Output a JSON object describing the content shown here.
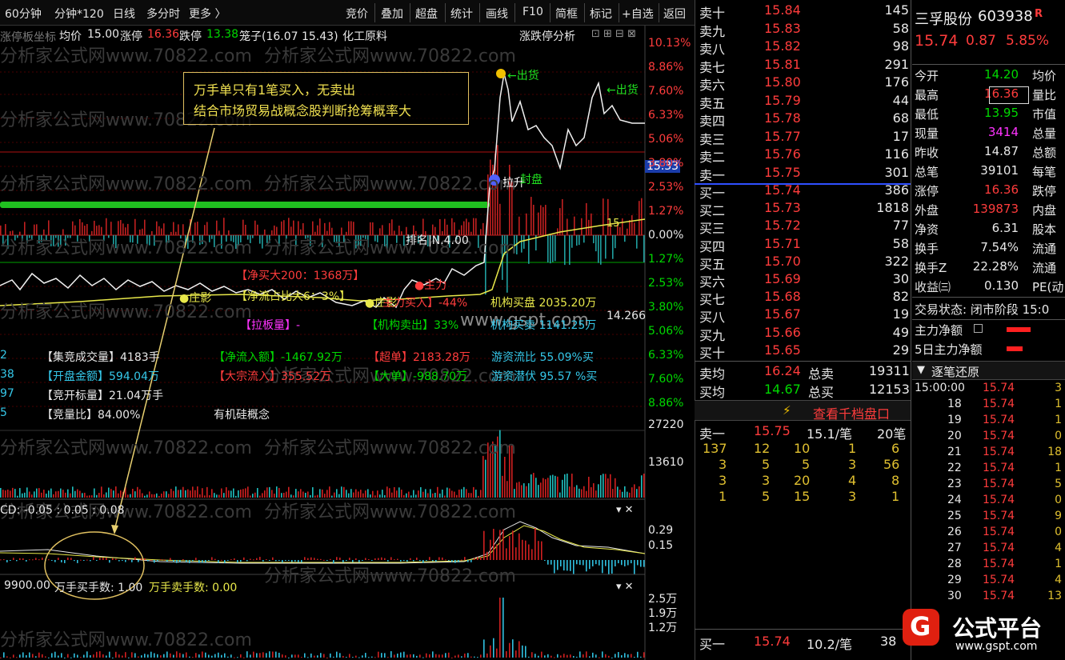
{
  "toolbar": {
    "left": [
      "60分钟",
      "分钟*120",
      "日线",
      "多分时",
      "更多 〉"
    ],
    "right": [
      "竞价",
      "叠加",
      "超盘",
      "统计",
      "画线",
      "F10",
      "简框",
      "标记",
      "+自选",
      "返回"
    ]
  },
  "header": {
    "mode": "涨停板坐标",
    "avg_label": "均价",
    "avg": "15.00",
    "up_label": "涨停",
    "up": "16.36",
    "down_label": "跌停",
    "down": "13.38",
    "cage": "笼子(16.07 15.43)",
    "sector": "化工原料",
    "analysis": "涨跌停分析"
  },
  "watermarks": [
    "分析家公式网www.70822.com",
    "www.gspt.com"
  ],
  "annotation": {
    "line1": "万手单只有1笔买入，无卖出",
    "line2": "结合市场贸易战概念股判断抢筹概率大"
  },
  "chart_labels": {
    "sell1": "←出货",
    "sell2": "←出货",
    "limit": "拉升",
    "sealed": "封盘",
    "rank": "排名|N.4.00",
    "net200": "【净买大200：1368万】",
    "zhuangying1": "●庄影",
    "netratio": "【净流占比大6：3%】",
    "zhuangying2": "●庄影",
    "zhuli": "●主力",
    "zhuli_in": "主力买入】-44%",
    "jigou_buy": "机构买盘 2035.20万",
    "laban": "【拉板量】-",
    "jigou_sell": "【机构卖出】33%",
    "jigou_net": "机构买卖 1141.25万",
    "price_low": "14.266",
    "ma15": "15",
    "price_tag": "15.33"
  },
  "info": {
    "left": [
      "2",
      "38",
      "97",
      "5"
    ],
    "jj_vol": "【集竞成交量】4183手",
    "open_amt": "【开盘金额】594.04万",
    "jk_vol": "【竞开标量】21.04万手",
    "jl_ratio": "【竞量比】84.00%",
    "net_in": "【净流入额】-1467.92万",
    "big_in": "【大宗流入】355.52万",
    "super": "【超单】2183.28万",
    "big": "【大单】-988.70万",
    "yz_ratio": "游资流比 55.09%买",
    "yz_hide": "游资潜伏 95.57 %买",
    "concept": "有机硅概念"
  },
  "pct_axis": [
    "10.13%",
    "8.86%",
    "7.60%",
    "6.33%",
    "5.06%",
    "3.80%",
    "2.53%",
    "1.27%",
    "0.00%",
    "1.27%",
    "2.53%",
    "3.80%",
    "5.06%",
    "6.33%",
    "7.60%",
    "8.86%"
  ],
  "vol_axis": [
    "27220",
    "13610"
  ],
  "macd": {
    "label": "CD: -0.05 : 0.05 : 0.08",
    "axis": [
      "0.29",
      "0.15"
    ]
  },
  "wan": {
    "left": "9900.00",
    "buy": "万手买手数: 1.00",
    "sell": "万手卖手数: 0.00",
    "axis": [
      "2.5万",
      "1.9万",
      "1.2万"
    ]
  },
  "orderbook": {
    "sell": [
      [
        "卖十",
        "15.84",
        "145"
      ],
      [
        "卖九",
        "15.83",
        "58"
      ],
      [
        "卖八",
        "15.82",
        "98"
      ],
      [
        "卖七",
        "15.81",
        "291"
      ],
      [
        "卖六",
        "15.80",
        "176"
      ],
      [
        "卖五",
        "15.79",
        "44"
      ],
      [
        "卖四",
        "15.78",
        "68"
      ],
      [
        "卖三",
        "15.77",
        "17"
      ],
      [
        "卖二",
        "15.76",
        "116"
      ],
      [
        "卖一",
        "15.75",
        "301"
      ]
    ],
    "buy": [
      [
        "买一",
        "15.74",
        "386"
      ],
      [
        "买二",
        "15.73",
        "1818"
      ],
      [
        "买三",
        "15.72",
        "77"
      ],
      [
        "买四",
        "15.71",
        "58"
      ],
      [
        "买五",
        "15.70",
        "322"
      ],
      [
        "买六",
        "15.69",
        "30"
      ],
      [
        "买七",
        "15.68",
        "82"
      ],
      [
        "买八",
        "15.67",
        "19"
      ],
      [
        "买九",
        "15.66",
        "49"
      ],
      [
        "买十",
        "15.65",
        "29"
      ]
    ],
    "sell_avg_l": "卖均",
    "sell_avg": "16.24",
    "total_sell_l": "总卖",
    "total_sell": "19311",
    "buy_avg_l": "买均",
    "buy_avg": "14.67",
    "total_buy_l": "总买",
    "total_buy": "12153",
    "queue_title": "查看千档盘口",
    "queue_head": [
      "卖一",
      "15.75",
      "15.1/笔",
      "20笔"
    ],
    "queue": [
      [
        "137",
        "12",
        "10",
        "1",
        "6"
      ],
      [
        "3",
        "5",
        "5",
        "3",
        "56"
      ],
      [
        "3",
        "3",
        "20",
        "4",
        "8"
      ],
      [
        "1",
        "5",
        "15",
        "3",
        "1"
      ]
    ],
    "bottom": [
      "买一",
      "15.74",
      "10.2/笔",
      "38"
    ]
  },
  "stock": {
    "name": "三孚股份",
    "code": "603938",
    "badge": "R",
    "price": "15.74",
    "chg": "0.87",
    "pct": "5.85%",
    "rows": [
      [
        "今开",
        "14.20",
        "均价"
      ],
      [
        "最高",
        "16.36",
        "量比"
      ],
      [
        "最低",
        "13.95",
        "市值"
      ],
      [
        "现量",
        "3414",
        "总量"
      ],
      [
        "昨收",
        "14.87",
        "总额"
      ],
      [
        "总笔",
        "39101",
        "每笔"
      ],
      [
        "涨停",
        "16.36",
        "跌停"
      ],
      [
        "外盘",
        "139873",
        "内盘"
      ],
      [
        "净资",
        "6.31",
        "股本"
      ],
      [
        "换手",
        "7.54%",
        "流通"
      ],
      [
        "换手Z",
        "22.28%",
        "流通"
      ],
      [
        "收益㈢",
        "0.130",
        "PE(动"
      ]
    ],
    "status": "交易状态: 闭市阶段 15:0",
    "zhuli": "主力净额",
    "zhuli5": "5日主力净额",
    "tick_title": "逐笔还原"
  },
  "ticks": [
    [
      "15:00:00",
      "15.74",
      "3"
    ],
    [
      "18",
      "15.74",
      "1"
    ],
    [
      "19",
      "15.74",
      "1"
    ],
    [
      "20",
      "15.74",
      "0"
    ],
    [
      "21",
      "15.74",
      "18"
    ],
    [
      "22",
      "15.74",
      "1"
    ],
    [
      "23",
      "15.74",
      "5"
    ],
    [
      "24",
      "15.74",
      "0"
    ],
    [
      "25",
      "15.74",
      "9"
    ],
    [
      "26",
      "15.74",
      "0"
    ],
    [
      "27",
      "15.74",
      "4"
    ],
    [
      "28",
      "15.74",
      "1"
    ],
    [
      "29",
      "15.74",
      "4"
    ],
    [
      "30",
      "15.74",
      "13"
    ]
  ],
  "logo": {
    "text": "公式平台",
    "url": "www.gspt.com"
  },
  "colors": {
    "up": "#ff3c3c",
    "down": "#00d800",
    "accent": "#e8e84a",
    "bg": "#000000"
  }
}
